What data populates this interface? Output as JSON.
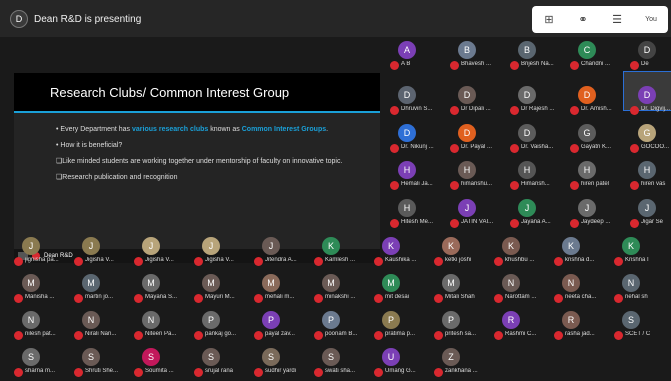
{
  "topbar": {
    "presenter_initial": "D",
    "presenter_text": "Dean R&D is presenting",
    "toolbar": [
      "⊞",
      "⚭",
      "☰"
    ],
    "you_label": "You"
  },
  "slide": {
    "title": "Research Clubs/ Common Interest Group",
    "bullets": [
      {
        "pre": "Every Department has ",
        "hl": "various research clubs",
        "post": " known as ",
        "hl2": "Common Interest Groups",
        "end": "."
      },
      {
        "pre": "How it is beneficial?",
        "hl": "",
        "post": "",
        "hl2": "",
        "end": ""
      },
      {
        "pre": "❑Like minded students are working together under mentorship of faculty on innovative topic.",
        "hl": "",
        "post": "",
        "hl2": "",
        "end": ""
      },
      {
        "pre": "❑Research publication and recognition",
        "hl": "",
        "post": "",
        "hl2": "",
        "end": ""
      }
    ]
  },
  "presenter_tile": {
    "name": "Dean R&D"
  },
  "colors": {
    "accent": "#1aa0d8",
    "muted_mic": "#d9282f"
  },
  "participants": [
    {
      "n": "A B",
      "i": "A",
      "c": "#7b3fb5"
    },
    {
      "n": "Bhavesh ...",
      "i": "B",
      "c": "#6b7a8f"
    },
    {
      "n": "Brijesh Na...",
      "i": "B",
      "c": "#5a6670"
    },
    {
      "n": "Chandni ...",
      "i": "C",
      "c": "#2e8b57"
    },
    {
      "n": "De",
      "i": "D",
      "c": "#444"
    },
    {
      "n": "Dhruvin S...",
      "i": "D",
      "c": "#5c6470"
    },
    {
      "n": "Dr Dipali ...",
      "i": "D",
      "c": "#6a5a55"
    },
    {
      "n": "Dr Rajesh ...",
      "i": "D",
      "c": "#6a6a6a"
    },
    {
      "n": "Dr. Amish...",
      "i": "D",
      "c": "#e0601f"
    },
    {
      "n": "Dr. Digvij...",
      "i": "D",
      "c": "#7b3fb5"
    },
    {
      "n": "Dr. Nikunj ...",
      "i": "D",
      "c": "#2e6fd6"
    },
    {
      "n": "Dr. Payal ...",
      "i": "D",
      "c": "#e0601f"
    },
    {
      "n": "Dr. Vaisha...",
      "i": "D",
      "c": "#5c5c5c"
    },
    {
      "n": "Gayatri K...",
      "i": "G",
      "c": "#5c5c5c"
    },
    {
      "n": "GOCOO...",
      "i": "G",
      "c": "#b8a47a"
    },
    {
      "n": "Hemali Ja...",
      "i": "H",
      "c": "#7b3fb5"
    },
    {
      "n": "himanshu...",
      "i": "H",
      "c": "#6a5a55"
    },
    {
      "n": "Himansh...",
      "i": "H",
      "c": "#555"
    },
    {
      "n": "hiren patel",
      "i": "H",
      "c": "#6a6a6a"
    },
    {
      "n": "hiren vas",
      "i": "H",
      "c": "#5a6670"
    },
    {
      "n": "Hitesh Me...",
      "i": "H",
      "c": "#5a5a5a"
    },
    {
      "n": "JATIN VAI...",
      "i": "J",
      "c": "#7b3fb5"
    },
    {
      "n": "Jayana A...",
      "i": "J",
      "c": "#2e8b57"
    },
    {
      "n": "Jaydeep ...",
      "i": "J",
      "c": "#6a6a6a"
    },
    {
      "n": "Jigar Se",
      "i": "J",
      "c": "#5a6670"
    },
    {
      "n": "jignisha pa...",
      "i": "J",
      "c": "#8a7a50"
    },
    {
      "n": "Jigisha V...",
      "i": "J",
      "c": "#8a7a50"
    },
    {
      "n": "Jigisha V...",
      "i": "J",
      "c": "#b8a47a"
    },
    {
      "n": "Jigisha V...",
      "i": "J",
      "c": "#b8a47a"
    },
    {
      "n": "Jitendra A...",
      "i": "J",
      "c": "#6a5a55"
    },
    {
      "n": "Kamlesh ...",
      "i": "K",
      "c": "#2e8b57"
    },
    {
      "n": "Kaushika ...",
      "i": "K",
      "c": "#7b3fb5"
    },
    {
      "n": "ketki joshi",
      "i": "K",
      "c": "#9a6a5a"
    },
    {
      "n": "khushbu ...",
      "i": "K",
      "c": "#7a5a50"
    },
    {
      "n": "krishna d...",
      "i": "K",
      "c": "#6b7a8f"
    },
    {
      "n": "Krishna I",
      "i": "K",
      "c": "#2e8b57"
    },
    {
      "n": "Manisha ...",
      "i": "M",
      "c": "#6a5a55"
    },
    {
      "n": "martin jo...",
      "i": "M",
      "c": "#5a6670"
    },
    {
      "n": "Mayana S...",
      "i": "M",
      "c": "#6a6a6a"
    },
    {
      "n": "Mayuri M...",
      "i": "M",
      "c": "#6a5a55"
    },
    {
      "n": "mehali m...",
      "i": "M",
      "c": "#8a6a5a"
    },
    {
      "n": "minakshi ...",
      "i": "M",
      "c": "#6a5a55"
    },
    {
      "n": "mit desai",
      "i": "M",
      "c": "#2e8b57"
    },
    {
      "n": "Mitali Shah",
      "i": "M",
      "c": "#6a6a6a"
    },
    {
      "n": "Narottam ...",
      "i": "N",
      "c": "#6a5a55"
    },
    {
      "n": "neeta cha...",
      "i": "N",
      "c": "#7a5a50"
    },
    {
      "n": "nehal sh",
      "i": "N",
      "c": "#5a6670"
    },
    {
      "n": "nilesh pat...",
      "i": "N",
      "c": "#6a6a6a"
    },
    {
      "n": "Nirali Nan...",
      "i": "N",
      "c": "#6a5a55"
    },
    {
      "n": "Niteen Pa...",
      "i": "N",
      "c": "#6a6a6a"
    },
    {
      "n": "pankaj go...",
      "i": "P",
      "c": "#6a6a6a"
    },
    {
      "n": "payal zav...",
      "i": "P",
      "c": "#7b3fb5"
    },
    {
      "n": "poonam B...",
      "i": "P",
      "c": "#6b7a8f"
    },
    {
      "n": "pratima p...",
      "i": "P",
      "c": "#8a7a50"
    },
    {
      "n": "pritesh sa...",
      "i": "P",
      "c": "#6a6a6a"
    },
    {
      "n": "Rashmi C...",
      "i": "R",
      "c": "#7b3fb5"
    },
    {
      "n": "rasha jad...",
      "i": "R",
      "c": "#7a5a50"
    },
    {
      "n": "SCET / C",
      "i": "S",
      "c": "#5a6670"
    },
    {
      "n": "sharna m...",
      "i": "S",
      "c": "#6a6a6a"
    },
    {
      "n": "Shruti She...",
      "i": "S",
      "c": "#6a5a55"
    },
    {
      "n": "Soumita ...",
      "i": "S",
      "c": "#c2185b"
    },
    {
      "n": "srujal rana",
      "i": "S",
      "c": "#6a5a55"
    },
    {
      "n": "sudhir yardi",
      "i": "S",
      "c": "#7a6a5a"
    },
    {
      "n": "swati sha...",
      "i": "S",
      "c": "#6a5a55"
    },
    {
      "n": "Umang G...",
      "i": "U",
      "c": "#7b3fb5"
    },
    {
      "n": "zankhana ...",
      "i": "Z",
      "c": "#6a5a55"
    }
  ]
}
